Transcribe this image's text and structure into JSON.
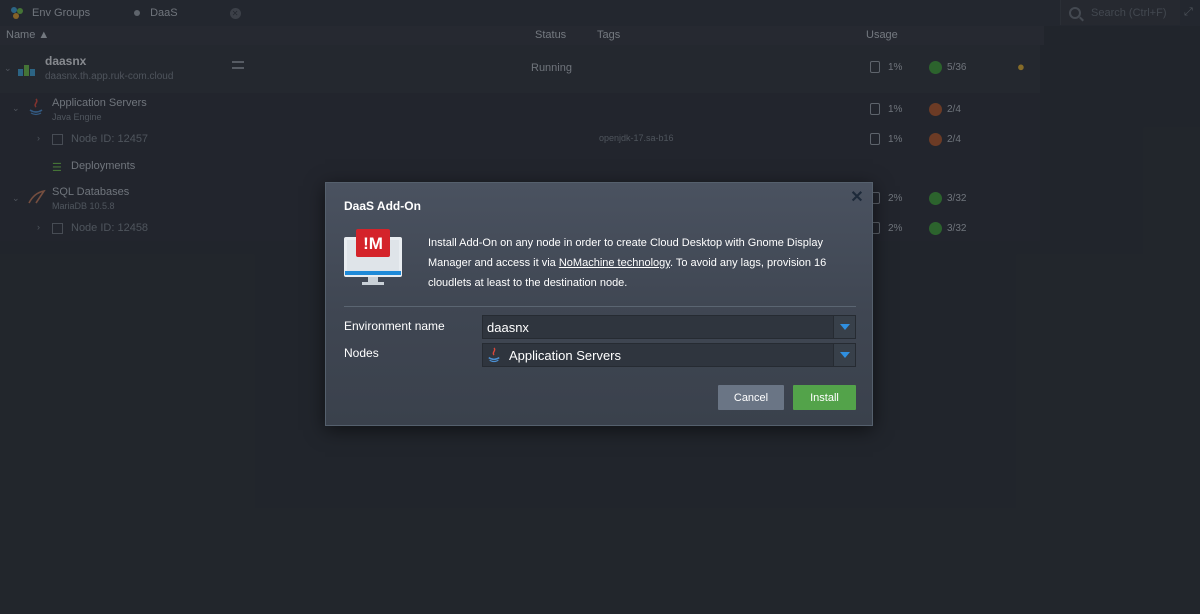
{
  "topbar": {
    "tabs": [
      {
        "label": "Env Groups"
      },
      {
        "label": "DaaS"
      }
    ],
    "search_placeholder": "Search (Ctrl+F)"
  },
  "header": {
    "name": "Name ▲",
    "status": "Status",
    "tags": "Tags",
    "usage": "Usage"
  },
  "environment": {
    "name": "daasnx",
    "domain": "daasnx.th.app.ruk-com.cloud",
    "status": "Running",
    "disk": "1%",
    "cloudlets": "5/36"
  },
  "groups": [
    {
      "title": "Application Servers",
      "subtitle": "Java Engine",
      "disk": "1%",
      "cloudlets": "2/4",
      "node": {
        "label": "Node ID: 12457",
        "tag": "openjdk-17.sa-b16",
        "disk": "1%",
        "cloudlets": "2/4"
      },
      "extra": "Deployments"
    },
    {
      "title": "SQL Databases",
      "subtitle": "MariaDB 10.5.8",
      "disk": "2%",
      "cloudlets": "3/32",
      "node": {
        "label": "Node ID: 12458",
        "disk": "2%",
        "cloudlets": "3/32"
      }
    }
  ],
  "dialog": {
    "title": "DaaS Add-On",
    "message_before": "Install Add-On on any node in order to create Cloud Desktop with Gnome Display Manager and access it via ",
    "message_link": "NoMachine technology",
    "message_after": ". To avoid any lags, provision 16 cloudlets at least to the destination node.",
    "env_label": "Environment name",
    "env_value": "daasnx",
    "nodes_label": "Nodes",
    "nodes_value": "Application Servers",
    "cancel": "Cancel",
    "install": "Install",
    "logo_text": "!M"
  },
  "colors": {
    "install": "#53a34a",
    "cancel": "#6a7585",
    "dropdown_arrow": "#2f8fe0",
    "logo_red": "#d4232a"
  }
}
